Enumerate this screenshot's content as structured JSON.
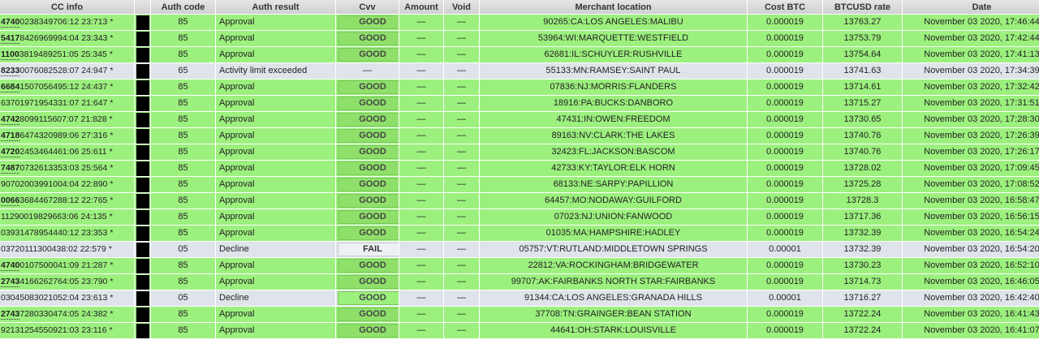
{
  "columns": [
    "CC info",
    "",
    "Auth code",
    "Auth result",
    "Cvv",
    "Amount",
    "Void",
    "Merchant location",
    "Cost BTC",
    "BTCUSD rate",
    "Date"
  ],
  "dash": "—",
  "rows": [
    {
      "cc_bold": "4740",
      "cc_rest": "0238349706:12 23:713",
      "star": "*",
      "auth_code": "85",
      "auth_result": "Approval",
      "cvv": "GOOD",
      "cvv_state": "good",
      "amount": "—",
      "void": "—",
      "location": "90265:CA:LOS ANGELES:MALIBU",
      "cost_btc": "0.000019",
      "btcusd": "13763.27",
      "date": "November 03 2020, 17:46:44",
      "status": "approval"
    },
    {
      "cc_bold": "5417",
      "cc_rest": "8426969994:04 23:343",
      "star": "*",
      "auth_code": "85",
      "auth_result": "Approval",
      "cvv": "GOOD",
      "cvv_state": "good",
      "amount": "—",
      "void": "—",
      "location": "53964:WI:MARQUETTE:WESTFIELD",
      "cost_btc": "0.000019",
      "btcusd": "13753.79",
      "date": "November 03 2020, 17:42:44",
      "status": "approval"
    },
    {
      "cc_bold": "1100",
      "cc_rest": "3819489251:05 25:345",
      "star": "*",
      "auth_code": "85",
      "auth_result": "Approval",
      "cvv": "GOOD",
      "cvv_state": "good",
      "amount": "—",
      "void": "—",
      "location": "62681:IL:SCHUYLER:RUSHVILLE",
      "cost_btc": "0.000019",
      "btcusd": "13754.64",
      "date": "November 03 2020, 17:41:13",
      "status": "approval"
    },
    {
      "cc_bold": "8233",
      "cc_rest": "0076082528:07 24:947",
      "star": "*",
      "auth_code": "65",
      "auth_result": "Activity limit exceeded",
      "cvv": "—",
      "cvv_state": "none",
      "amount": "—",
      "void": "—",
      "location": "55133:MN:RAMSEY:SAINT PAUL",
      "cost_btc": "0.000019",
      "btcusd": "13741.63",
      "date": "November 03 2020, 17:34:39",
      "status": "decline"
    },
    {
      "cc_bold": "6684",
      "cc_rest": "1507056495:12 24:437",
      "star": "*",
      "auth_code": "85",
      "auth_result": "Approval",
      "cvv": "GOOD",
      "cvv_state": "good",
      "amount": "—",
      "void": "—",
      "location": "07836:NJ:MORRIS:FLANDERS",
      "cost_btc": "0.000019",
      "btcusd": "13714.61",
      "date": "November 03 2020, 17:32:42",
      "status": "approval"
    },
    {
      "cc_bold": "",
      "cc_rest": "63701971954331:07 21:647",
      "star": "*",
      "auth_code": "85",
      "auth_result": "Approval",
      "cvv": "GOOD",
      "cvv_state": "good",
      "amount": "—",
      "void": "—",
      "location": "18916:PA:BUCKS:DANBORO",
      "cost_btc": "0.000019",
      "btcusd": "13715.27",
      "date": "November 03 2020, 17:31:51",
      "status": "approval"
    },
    {
      "cc_bold": "4742",
      "cc_rest": "8099115607:07 21:828",
      "star": "*",
      "auth_code": "85",
      "auth_result": "Approval",
      "cvv": "GOOD",
      "cvv_state": "good",
      "amount": "—",
      "void": "—",
      "location": "47431:IN:OWEN:FREEDOM",
      "cost_btc": "0.000019",
      "btcusd": "13730.65",
      "date": "November 03 2020, 17:28:30",
      "status": "approval"
    },
    {
      "cc_bold": "4718",
      "cc_rest": "6474320989:06 27:316",
      "star": "*",
      "auth_code": "85",
      "auth_result": "Approval",
      "cvv": "GOOD",
      "cvv_state": "good",
      "amount": "—",
      "void": "—",
      "location": "89163:NV:CLARK:THE LAKES",
      "cost_btc": "0.000019",
      "btcusd": "13740.76",
      "date": "November 03 2020, 17:26:39",
      "status": "approval"
    },
    {
      "cc_bold": "4720",
      "cc_rest": "2453464461:06 25:611",
      "star": "*",
      "auth_code": "85",
      "auth_result": "Approval",
      "cvv": "GOOD",
      "cvv_state": "good",
      "amount": "—",
      "void": "—",
      "location": "32423:FL:JACKSON:BASCOM",
      "cost_btc": "0.000019",
      "btcusd": "13740.76",
      "date": "November 03 2020, 17:26:17",
      "status": "approval"
    },
    {
      "cc_bold": "7487",
      "cc_rest": "0732613353:03 25:564",
      "star": "*",
      "auth_code": "85",
      "auth_result": "Approval",
      "cvv": "GOOD",
      "cvv_state": "good",
      "amount": "—",
      "void": "—",
      "location": "42733:KY:TAYLOR:ELK HORN",
      "cost_btc": "0.000019",
      "btcusd": "13728.02",
      "date": "November 03 2020, 17:09:45",
      "status": "approval"
    },
    {
      "cc_bold": "",
      "cc_rest": "90702003991004:04 22:890",
      "star": "*",
      "auth_code": "85",
      "auth_result": "Approval",
      "cvv": "GOOD",
      "cvv_state": "good",
      "amount": "—",
      "void": "—",
      "location": "68133:NE:SARPY:PAPILLION",
      "cost_btc": "0.000019",
      "btcusd": "13725.28",
      "date": "November 03 2020, 17:08:52",
      "status": "approval"
    },
    {
      "cc_bold": "0066",
      "cc_rest": "3684467288:12 22:765",
      "star": "*",
      "auth_code": "85",
      "auth_result": "Approval",
      "cvv": "GOOD",
      "cvv_state": "good",
      "amount": "—",
      "void": "—",
      "location": "64457:MO:NODAWAY:GUILFORD",
      "cost_btc": "0.000019",
      "btcusd": "13728.3",
      "date": "November 03 2020, 16:58:47",
      "status": "approval"
    },
    {
      "cc_bold": "",
      "cc_rest": "11290019829663:06 24:135",
      "star": "*",
      "auth_code": "85",
      "auth_result": "Approval",
      "cvv": "GOOD",
      "cvv_state": "good",
      "amount": "—",
      "void": "—",
      "location": "07023:NJ:UNION:FANWOOD",
      "cost_btc": "0.000019",
      "btcusd": "13717.36",
      "date": "November 03 2020, 16:56:15",
      "status": "approval"
    },
    {
      "cc_bold": "",
      "cc_rest": "03931478954440:12 23:353",
      "star": "*",
      "auth_code": "85",
      "auth_result": "Approval",
      "cvv": "GOOD",
      "cvv_state": "good",
      "amount": "—",
      "void": "—",
      "location": "01035:MA:HAMPSHIRE:HADLEY",
      "cost_btc": "0.000019",
      "btcusd": "13732.39",
      "date": "November 03 2020, 16:54:24",
      "status": "approval"
    },
    {
      "cc_bold": "",
      "cc_rest": "03720111300438:02 22:579",
      "star": "*",
      "auth_code": "05",
      "auth_result": "Decline",
      "cvv": "FAIL",
      "cvv_state": "fail",
      "amount": "—",
      "void": "—",
      "location": "05757:VT:RUTLAND:MIDDLETOWN SPRINGS",
      "cost_btc": "0.00001",
      "btcusd": "13732.39",
      "date": "November 03 2020, 16:54:20",
      "status": "decline"
    },
    {
      "cc_bold": "4740",
      "cc_rest": "0107500041:09 21:287",
      "star": "*",
      "auth_code": "85",
      "auth_result": "Approval",
      "cvv": "GOOD",
      "cvv_state": "good",
      "amount": "—",
      "void": "—",
      "location": "22812:VA:ROCKINGHAM:BRIDGEWATER",
      "cost_btc": "0.000019",
      "btcusd": "13730.23",
      "date": "November 03 2020, 16:52:10",
      "status": "approval"
    },
    {
      "cc_bold": "2743",
      "cc_rest": "4166262764:05 23:790",
      "star": "*",
      "auth_code": "85",
      "auth_result": "Approval",
      "cvv": "GOOD",
      "cvv_state": "good",
      "amount": "—",
      "void": "—",
      "location": "99707:AK:FAIRBANKS NORTH STAR:FAIRBANKS",
      "cost_btc": "0.000019",
      "btcusd": "13714.73",
      "date": "November 03 2020, 16:46:05",
      "status": "approval"
    },
    {
      "cc_bold": "",
      "cc_rest": "03045083021052:04 23:613",
      "star": "*",
      "auth_code": "05",
      "auth_result": "Decline",
      "cvv": "GOOD",
      "cvv_state": "good",
      "amount": "—",
      "void": "—",
      "location": "91344:CA:LOS ANGELES:GRANADA HILLS",
      "cost_btc": "0.00001",
      "btcusd": "13716.27",
      "date": "November 03 2020, 16:42:40",
      "status": "decline"
    },
    {
      "cc_bold": "2743",
      "cc_rest": "7280330474:05 24:382",
      "star": "*",
      "auth_code": "85",
      "auth_result": "Approval",
      "cvv": "GOOD",
      "cvv_state": "good",
      "amount": "—",
      "void": "—",
      "location": "37708:TN:GRAINGER:BEAN STATION",
      "cost_btc": "0.000019",
      "btcusd": "13722.24",
      "date": "November 03 2020, 16:41:43",
      "status": "approval"
    },
    {
      "cc_bold": "",
      "cc_rest": "92131254550921:03 23:116",
      "star": "*",
      "auth_code": "85",
      "auth_result": "Approval",
      "cvv": "GOOD",
      "cvv_state": "good",
      "amount": "—",
      "void": "—",
      "location": "44641:OH:STARK:LOUISVILLE",
      "cost_btc": "0.000019",
      "btcusd": "13722.24",
      "date": "November 03 2020, 16:41:07",
      "status": "approval"
    }
  ]
}
